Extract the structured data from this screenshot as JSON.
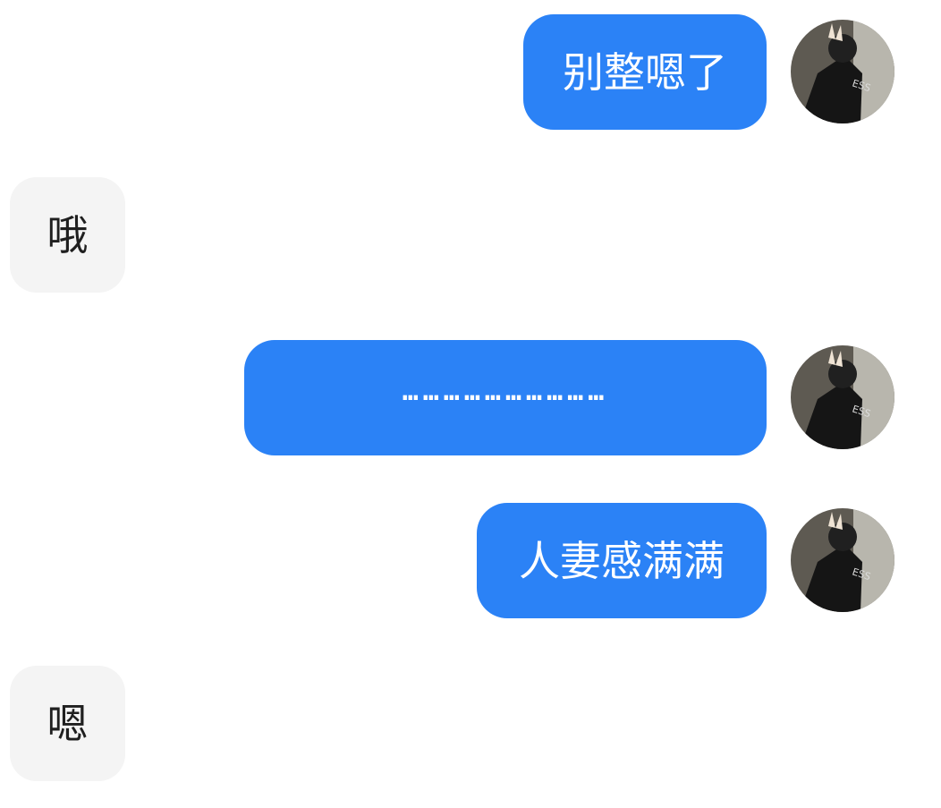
{
  "chat": {
    "messages": [
      {
        "sender": "me",
        "text": "别整嗯了"
      },
      {
        "sender": "other",
        "text": "哦"
      },
      {
        "sender": "me",
        "text": "…………………………"
      },
      {
        "sender": "me",
        "text": "人妻感满满"
      },
      {
        "sender": "other",
        "text": "嗯"
      }
    ],
    "avatar_icon": "user-photo-avatar",
    "avatar_shirt_text": "ESS"
  },
  "colors": {
    "sent_bubble": "#2b82f6",
    "sent_text": "#ffffff",
    "received_bubble": "#f4f4f4",
    "received_text": "#1f1f1f",
    "background": "#ffffff"
  }
}
